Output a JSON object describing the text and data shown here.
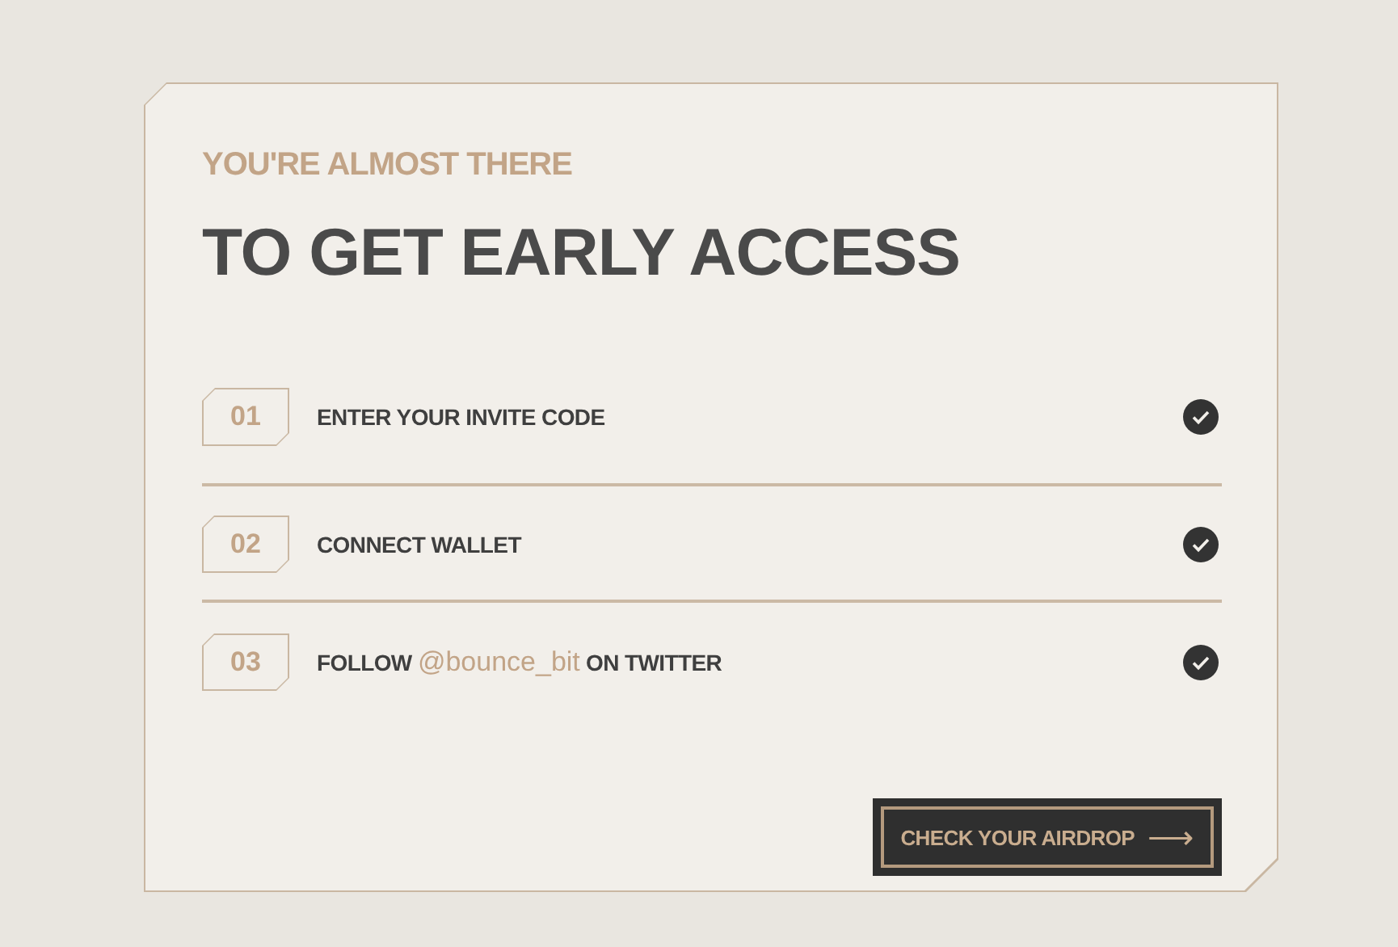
{
  "card": {
    "subtitle": "YOU'RE ALMOST THERE",
    "title": "TO GET EARLY ACCESS",
    "steps": [
      {
        "number": "01",
        "parts": [
          {
            "kind": "text",
            "text": "ENTER YOUR INVITE CODE"
          }
        ],
        "done": true
      },
      {
        "number": "02",
        "parts": [
          {
            "kind": "text",
            "text": "CONNECT WALLET"
          }
        ],
        "done": true
      },
      {
        "number": "03",
        "parts": [
          {
            "kind": "text",
            "text": "FOLLOW "
          },
          {
            "kind": "link",
            "text": "@bounce_bit"
          },
          {
            "kind": "text",
            "text": " ON TWITTER"
          }
        ],
        "done": true
      }
    ],
    "button": {
      "label": "CHECK YOUR AIRDROP",
      "arrow": "⟶"
    }
  }
}
